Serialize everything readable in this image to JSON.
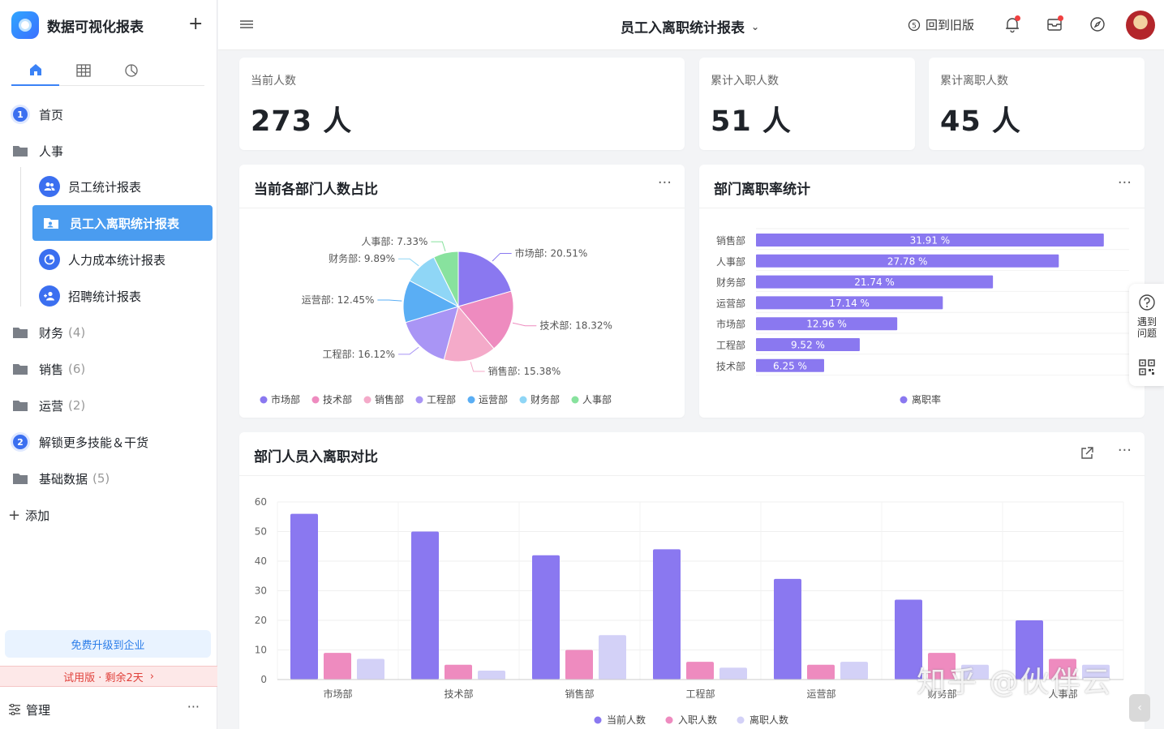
{
  "app": {
    "name": "数据可视化报表",
    "add_icon": "plus-icon"
  },
  "sidebar": {
    "tabs": [
      {
        "icon": "home-icon",
        "active": true
      },
      {
        "icon": "table-icon",
        "active": false
      },
      {
        "icon": "pie-chart-icon",
        "active": false
      }
    ],
    "items": [
      {
        "label": "首页",
        "badge": "1"
      },
      {
        "label": "人事"
      },
      {
        "label": "员工统计报表"
      },
      {
        "label": "员工入离职统计报表"
      },
      {
        "label": "人力成本统计报表"
      },
      {
        "label": "招聘统计报表"
      },
      {
        "label": "财务",
        "count": "(4)"
      },
      {
        "label": "销售",
        "count": "(6)"
      },
      {
        "label": "运营",
        "count": "(2)"
      },
      {
        "label": "解锁更多技能＆干货",
        "badge": "2"
      },
      {
        "label": "基础数据",
        "count": "(5)"
      }
    ],
    "add_label": "添加",
    "upgrade_label": "免费升级到企业",
    "trial_label": "试用版 · 剩余2天",
    "manage_label": "管理",
    "manage_more": "···"
  },
  "header": {
    "report_title": "员工入离职统计报表",
    "old_version_label": "回到旧版",
    "accent_color": "#4a9cf0"
  },
  "stats": [
    {
      "label": "当前人数",
      "value": "273 人"
    },
    {
      "label": "累计入职人数",
      "value": "51 人"
    },
    {
      "label": "累计离职人数",
      "value": "45 人"
    }
  ],
  "float_bar": {
    "help_label": "遇到问题"
  },
  "watermark": "知乎 @伙伴云",
  "chart_data": [
    {
      "type": "pie",
      "title": "当前各部门人数占比",
      "more": "···",
      "slices": [
        {
          "name": "市场部",
          "value": 20.51,
          "label": "市场部: 20.51%",
          "color": "#8a78f0"
        },
        {
          "name": "技术部",
          "value": 18.32,
          "label": "技术部: 18.32%",
          "color": "#ee8bbf"
        },
        {
          "name": "销售部",
          "value": 15.38,
          "label": "销售部: 15.38%",
          "color": "#f4aac9"
        },
        {
          "name": "工程部",
          "value": 16.12,
          "label": "工程部: 16.12%",
          "color": "#a995f5"
        },
        {
          "name": "运营部",
          "value": 12.45,
          "label": "运营部: 12.45%",
          "color": "#5aaef4"
        },
        {
          "name": "财务部",
          "value": 9.89,
          "label": "财务部: 9.89%",
          "color": "#8fd6f6"
        },
        {
          "name": "人事部",
          "value": 7.33,
          "label": "人事部: 7.33%",
          "color": "#88e29e"
        }
      ],
      "legend": [
        "市场部",
        "技术部",
        "销售部",
        "工程部",
        "运营部",
        "财务部",
        "人事部"
      ],
      "legend_position": "bottom"
    },
    {
      "type": "bar",
      "orientation": "horizontal",
      "title": "部门离职率统计",
      "more": "···",
      "categories": [
        "销售部",
        "人事部",
        "财务部",
        "运营部",
        "市场部",
        "工程部",
        "技术部"
      ],
      "values": [
        31.91,
        27.78,
        21.74,
        17.14,
        12.96,
        9.52,
        6.25
      ],
      "value_labels": [
        "31.91 %",
        "27.78 %",
        "21.74 %",
        "17.14 %",
        "12.96 %",
        "9.52 %",
        "6.25 %"
      ],
      "series": [
        {
          "name": "离职率",
          "color": "#8a78f0"
        }
      ],
      "xlim": [
        0,
        32
      ],
      "legend_position": "bottom"
    },
    {
      "type": "bar",
      "title": "部门人员入离职对比",
      "more": "···",
      "categories": [
        "市场部",
        "技术部",
        "销售部",
        "工程部",
        "运营部",
        "财务部",
        "人事部"
      ],
      "series": [
        {
          "name": "当前人数",
          "color": "#8a78f0",
          "values": [
            56,
            50,
            42,
            44,
            34,
            27,
            20
          ]
        },
        {
          "name": "入职人数",
          "color": "#ee8bbf",
          "values": [
            9,
            5,
            10,
            6,
            5,
            9,
            7
          ]
        },
        {
          "name": "离职人数",
          "color": "#d3d1f7",
          "values": [
            7,
            3,
            15,
            4,
            6,
            5,
            5
          ]
        }
      ],
      "yticks": [
        "0",
        "10",
        "20",
        "30",
        "40",
        "50",
        "60"
      ],
      "ylim": [
        0,
        60
      ],
      "grid": true,
      "legend_position": "bottom"
    }
  ]
}
